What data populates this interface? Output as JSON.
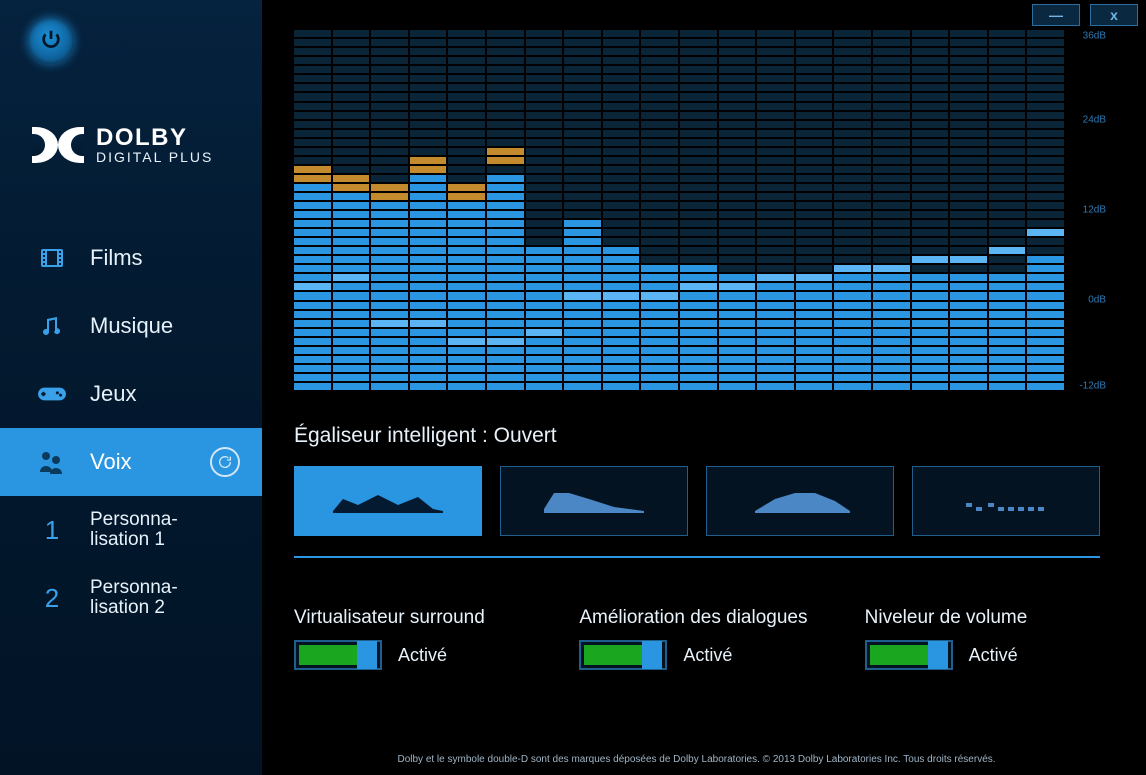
{
  "brand": {
    "line1": "DOLBY",
    "line2": "DIGITAL PLUS"
  },
  "window": {
    "minimize": "—",
    "close": "x"
  },
  "sidebar": {
    "items": [
      {
        "label": "Films",
        "icon": "film"
      },
      {
        "label": "Musique",
        "icon": "music"
      },
      {
        "label": "Jeux",
        "icon": "gamepad"
      },
      {
        "label": "Voix",
        "icon": "voice",
        "active": true
      },
      {
        "label": "Personna-\nlisation 1",
        "index": "1"
      },
      {
        "label": "Personna-\nlisation 2",
        "index": "2"
      }
    ]
  },
  "eq": {
    "segments": 40,
    "zero_segment": 10,
    "db_labels": [
      {
        "text": "36dB",
        "seg": 40
      },
      {
        "text": "24dB",
        "seg": 30
      },
      {
        "text": "12dB",
        "seg": 20
      },
      {
        "text": "0dB",
        "seg": 10
      },
      {
        "text": "-12dB",
        "seg": 0
      }
    ],
    "bars": [
      {
        "fill": 24,
        "peak": 25,
        "marker": 12
      },
      {
        "fill": 23,
        "peak": 24,
        "marker": 13
      },
      {
        "fill": 22,
        "peak": 23,
        "marker": 8
      },
      {
        "fill": 24,
        "peak": 26,
        "marker": 8
      },
      {
        "fill": 22,
        "peak": 23,
        "marker": 6
      },
      {
        "fill": 24,
        "peak": 27,
        "marker": 6
      },
      {
        "fill": 16,
        "peak": 16,
        "marker": 7
      },
      {
        "fill": 19,
        "peak": 19,
        "marker": 11
      },
      {
        "fill": 16,
        "peak": 16,
        "marker": 11
      },
      {
        "fill": 14,
        "peak": 14,
        "marker": 11
      },
      {
        "fill": 14,
        "peak": 14,
        "marker": 12
      },
      {
        "fill": 13,
        "peak": 13,
        "marker": 12
      },
      {
        "fill": 13,
        "peak": 13,
        "marker": 13
      },
      {
        "fill": 13,
        "peak": 13,
        "marker": 13
      },
      {
        "fill": 13,
        "peak": 13,
        "marker": 14
      },
      {
        "fill": 13,
        "peak": 13,
        "marker": 14
      },
      {
        "fill": 13,
        "peak": 13,
        "marker": 15
      },
      {
        "fill": 13,
        "peak": 13,
        "marker": 15
      },
      {
        "fill": 13,
        "peak": 13,
        "marker": 16
      },
      {
        "fill": 15,
        "peak": 15,
        "marker": 18
      }
    ]
  },
  "equalizer_title": "Égaliseur intelligent : Ouvert",
  "presets": [
    {
      "name": "preset-open",
      "active": true
    },
    {
      "name": "preset-rich",
      "active": false
    },
    {
      "name": "preset-focus",
      "active": false
    },
    {
      "name": "preset-flat",
      "active": false
    }
  ],
  "toggles": [
    {
      "label": "Virtualisateur surround",
      "state": "Activé",
      "on": true
    },
    {
      "label": "Amélioration des dialogues",
      "state": "Activé",
      "on": true
    },
    {
      "label": "Niveleur de volume",
      "state": "Activé",
      "on": true
    }
  ],
  "footer": "Dolby et le symbole double-D sont des marques déposées de Dolby Laboratories. © 2013 Dolby Laboratories Inc. Tous droits réservés."
}
